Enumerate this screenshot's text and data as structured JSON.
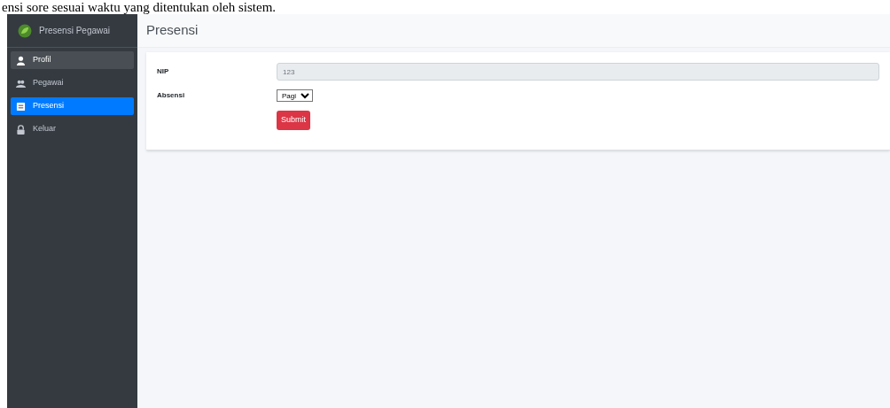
{
  "caption": "ensi sore sesuai waktu yang ditentukan oleh sistem.",
  "brand": "Presensi Pegawai",
  "sidebar": {
    "items": [
      {
        "label": "Profil",
        "kind": "user",
        "selected": false,
        "hover": true
      },
      {
        "label": "Pegawai",
        "kind": "users",
        "selected": false,
        "hover": false
      },
      {
        "label": "Presensi",
        "kind": "list",
        "selected": true,
        "hover": false
      },
      {
        "label": "Keluar",
        "kind": "lock",
        "selected": false,
        "hover": false
      }
    ]
  },
  "page_title": "Presensi",
  "form": {
    "fields": [
      {
        "kind": "text",
        "label": "NIP",
        "value": "123",
        "disabled": true
      },
      {
        "kind": "select",
        "label": "Absensi",
        "value": "Pagi"
      }
    ],
    "submit": "Submit"
  }
}
